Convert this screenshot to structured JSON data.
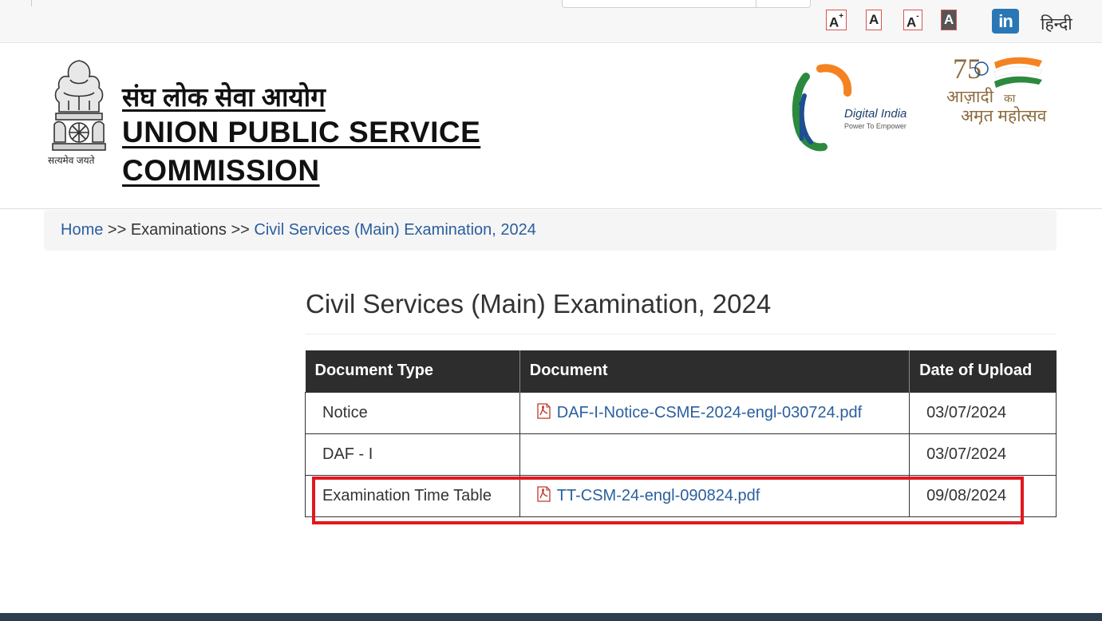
{
  "topbar": {
    "font_buttons": [
      {
        "label": "A",
        "sup": "+"
      },
      {
        "label": "A",
        "sup": ""
      },
      {
        "label": "A",
        "sup": "-"
      },
      {
        "label": "A",
        "sup": ""
      }
    ],
    "linkedin_label": "in",
    "hindi_link": "हिन्दी"
  },
  "header": {
    "emblem_caption": "सत्यमेव जयते",
    "title_hindi": "संघ लोक सेवा आयोग",
    "title_english": "UNION PUBLIC SERVICE COMMISSION",
    "digital_india_title": "Digital India",
    "digital_india_tagline": "Power To Empower",
    "azadi_number": "75",
    "azadi_line1": "आज़ादी",
    "azadi_ka": "का",
    "azadi_line2": "अमृत महोत्सव"
  },
  "breadcrumb": {
    "home": "Home",
    "separator": ">>",
    "section": "Examinations",
    "current": "Civil Services (Main) Examination, 2024"
  },
  "main": {
    "page_title": "Civil Services (Main) Examination, 2024",
    "table": {
      "headers": [
        "Document Type",
        "Document",
        "Date of Upload"
      ],
      "rows": [
        {
          "type": "Notice",
          "document": "DAF-I-Notice-CSME-2024-engl-030724.pdf",
          "date": "03/07/2024"
        },
        {
          "type": "DAF - I",
          "document": "",
          "date": "03/07/2024"
        },
        {
          "type": "Examination Time Table",
          "document": "TT-CSM-24-engl-090824.pdf",
          "date": "09/08/2024"
        }
      ]
    }
  },
  "colors": {
    "link": "#2a5f9e",
    "table_header_bg": "#2d2d2d",
    "highlight": "#e3181d"
  }
}
